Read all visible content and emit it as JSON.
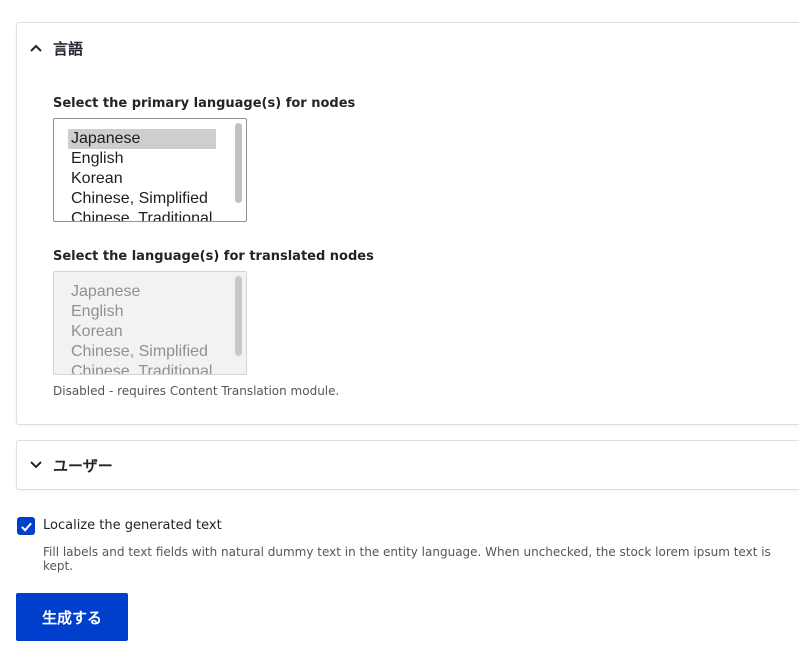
{
  "language_section": {
    "title": "言語",
    "primary_label": "Select the primary language(s) for nodes",
    "primary_options": [
      {
        "label": "Japanese",
        "selected": true
      },
      {
        "label": "English"
      },
      {
        "label": "Korean"
      },
      {
        "label": "Chinese, Simplified"
      },
      {
        "label": "Chinese, Traditional"
      }
    ],
    "translated_label": "Select the language(s) for translated nodes",
    "translated_options": [
      {
        "label": "Japanese"
      },
      {
        "label": "English"
      },
      {
        "label": "Korean"
      },
      {
        "label": "Chinese, Simplified"
      },
      {
        "label": "Chinese, Traditional"
      }
    ],
    "translated_disabled_note": "Disabled - requires Content Translation module."
  },
  "user_section": {
    "title": "ユーザー"
  },
  "localize": {
    "checked": true,
    "label": "Localize the generated text",
    "description": "Fill labels and text fields with natural dummy text in the entity language. When unchecked, the stock lorem ipsum text is kept."
  },
  "submit_label": "生成する",
  "colors": {
    "accent": "#003ecc",
    "border": "#dedfe4"
  }
}
